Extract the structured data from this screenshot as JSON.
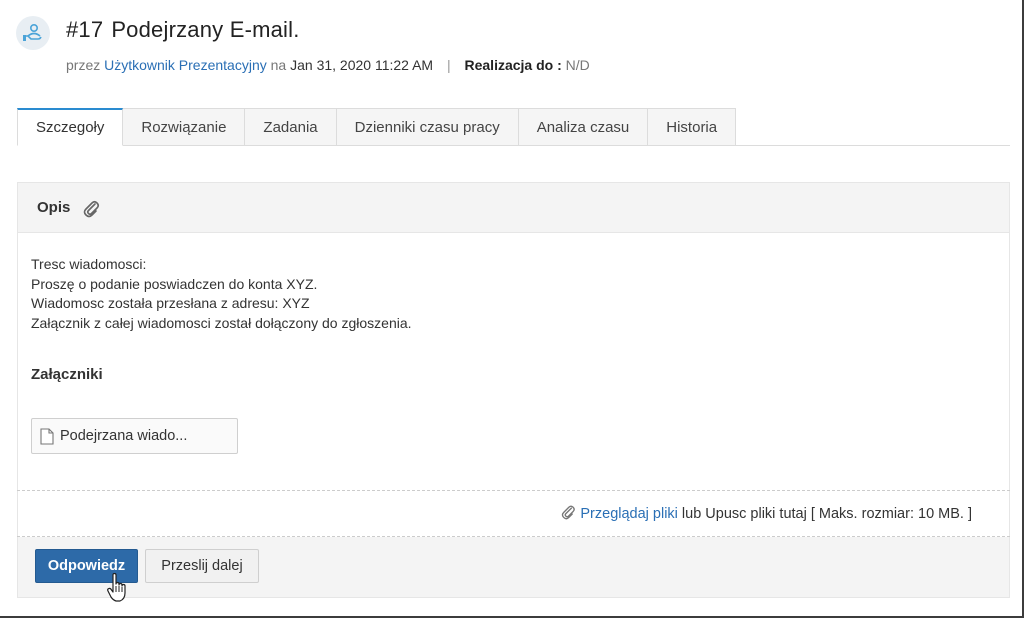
{
  "header": {
    "ticket_number": "#17",
    "ticket_title": "Podejrzany E-mail.",
    "by_label": "przez",
    "author": "Użytkownik Prezentacyjny",
    "on_label": "na",
    "date": "Jan 31, 2020 11:22 AM",
    "separator": "|",
    "due_label": "Realizacja do :",
    "due_value": "N/D"
  },
  "tabs": [
    {
      "label": "Szczegoły",
      "active": true
    },
    {
      "label": "Rozwiązanie"
    },
    {
      "label": "Zadania"
    },
    {
      "label": "Dzienniki czasu pracy"
    },
    {
      "label": "Analiza czasu"
    },
    {
      "label": "Historia"
    }
  ],
  "description": {
    "heading": "Opis",
    "lines": [
      "Tresc wiadomosci:",
      "Proszę o podanie poswiadczen do konta XYZ.",
      "Wiadomosc została przesłana z adresu: XYZ",
      "Załącznik z całej wiadomosci został dołączony do zgłoszenia."
    ]
  },
  "attachments": {
    "heading": "Załączniki",
    "files": [
      "Podejrzana wiado..."
    ]
  },
  "upload": {
    "browse_label": "Przeglądaj pliki",
    "rest_text": "lub Upusc pliki tutaj [ Maks. rozmiar: 10 MB. ]"
  },
  "actions": {
    "reply_label": "Odpowiedz",
    "forward_label": "Przeslij dalej"
  },
  "colors": {
    "link": "#2a6fb5",
    "primary_button": "#2d6aa8",
    "active_tab_accent": "#2a8bd0"
  }
}
